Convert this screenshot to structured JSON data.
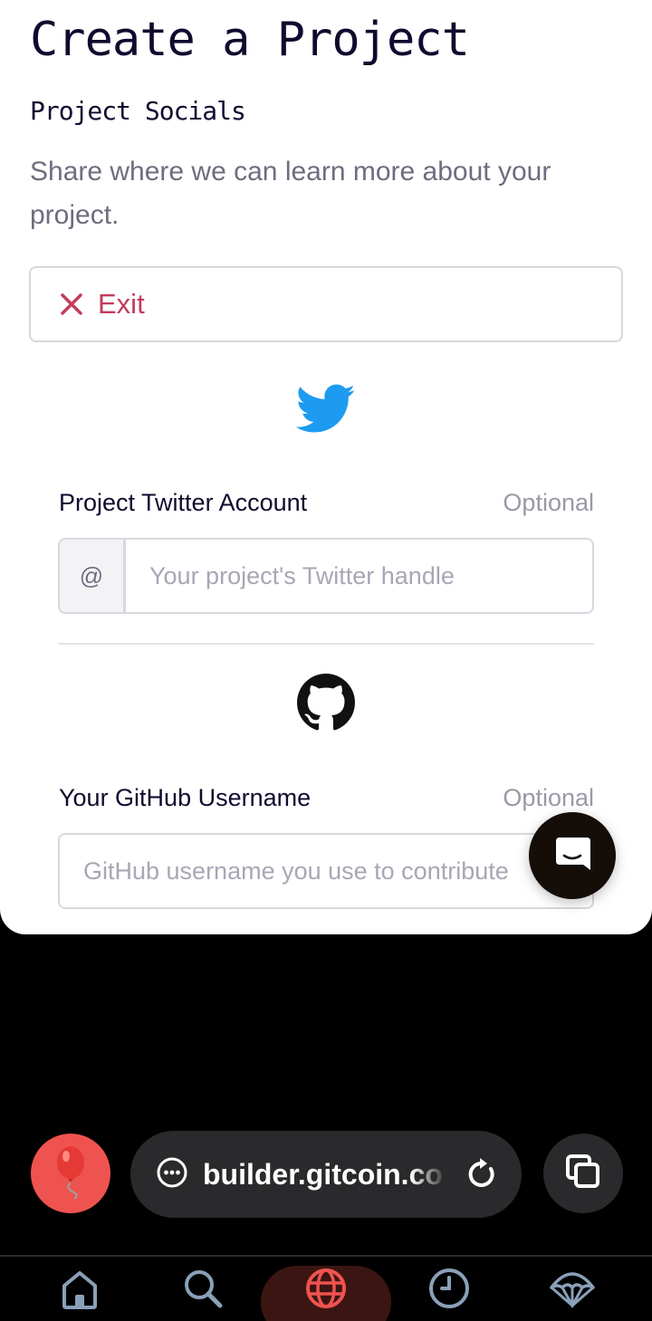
{
  "page": {
    "title": "Create a Project",
    "subtitle": "Project Socials",
    "description": "Share where we can learn more about your project.",
    "exit_label": "Exit"
  },
  "twitter": {
    "label": "Project Twitter Account",
    "optional": "Optional",
    "prefix": "@",
    "placeholder": "Your project's Twitter handle"
  },
  "github": {
    "label": "Your GitHub Username",
    "optional": "Optional",
    "placeholder": "GitHub username you use to contribute"
  },
  "browser": {
    "url": "builder.gitcoin.co"
  },
  "colors": {
    "accent_exit": "#c53b5d",
    "twitter_blue": "#1d9bf0",
    "nav_active": "#ef5350"
  },
  "icons": [
    "close-icon",
    "twitter-icon",
    "github-icon",
    "chat-icon",
    "balloon-icon",
    "site-info-icon",
    "reload-icon",
    "tabs-icon",
    "home-icon",
    "search-icon",
    "globe-icon",
    "history-icon",
    "parachute-icon"
  ]
}
